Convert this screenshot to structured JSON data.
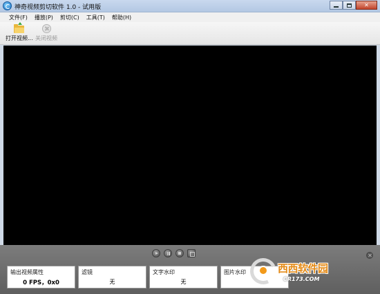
{
  "window": {
    "title": "神奇视频剪切软件 1.0 - 试用版"
  },
  "menu": {
    "items": [
      {
        "label": "文件(F)"
      },
      {
        "label": "播放(P)"
      },
      {
        "label": "剪切(C)"
      },
      {
        "label": "工具(T)"
      },
      {
        "label": "帮助(H)"
      }
    ]
  },
  "toolbar": {
    "open_label": "打开视频...",
    "close_label": "关闭视频"
  },
  "panel": {
    "output": {
      "title": "输出视频属性",
      "value": "0 FPS，0x0"
    },
    "filter": {
      "title": "滤镜",
      "value": "无"
    },
    "text_watermark": {
      "title": "文字水印",
      "value": "无"
    },
    "image_watermark": {
      "title": "图片水印",
      "value": ""
    }
  },
  "watermark": {
    "brand": "西西软件园",
    "url": "CR173.COM"
  },
  "colors": {
    "video_bg": "#000000",
    "panel_bg": "#6e6e6e",
    "titlebar": "#c2d4ea"
  }
}
